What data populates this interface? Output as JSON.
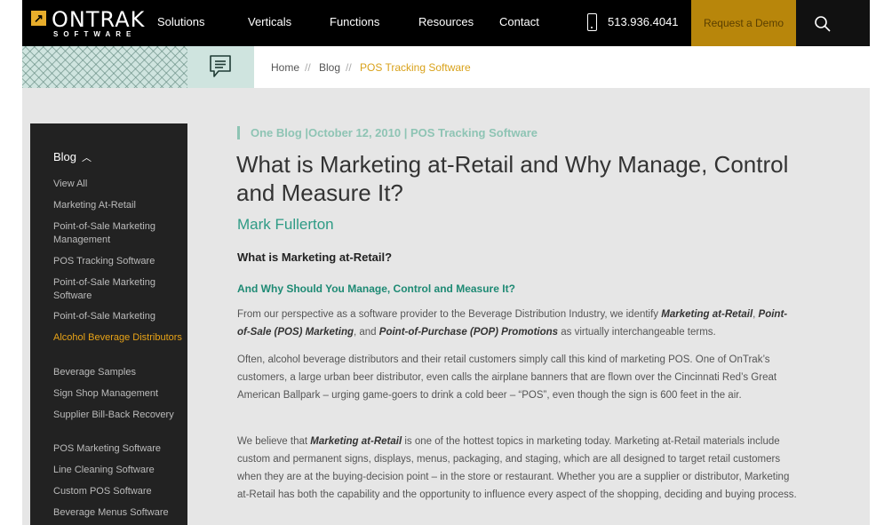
{
  "header": {
    "logo_mark": "↗",
    "logo_word": "ONTRAK",
    "logo_sub": "SOFTWARE",
    "nav": [
      "Solutions",
      "Verticals",
      "Functions",
      "Resources",
      "Contact"
    ],
    "phone": "513.936.4041",
    "demo_label": "Request a Demo",
    "icons": {
      "phone": "mobile-phone-icon",
      "search": "search-icon",
      "chat": "chat-bubble-icon"
    },
    "colors": {
      "bar": "#000000",
      "demo": "#b8860b",
      "accent": "#e8ad2b"
    }
  },
  "breadcrumb": {
    "home": "Home",
    "sep": "//",
    "blog": "Blog",
    "current": "POS Tracking Software"
  },
  "sidebar": {
    "heading": "Blog",
    "heading_icon": "chevron-up-icon",
    "items": [
      "View All",
      "Marketing At-Retail",
      "Point-of-Sale Marketing Management",
      "POS Tracking Software",
      "Point-of-Sale Marketing Software",
      "Point-of-Sale Marketing",
      "Alcohol Beverage Distributors",
      "Beverage Samples",
      "Sign Shop Management",
      "Supplier Bill-Back Recovery",
      "POS Marketing Software",
      "Line Cleaning Software",
      "Custom POS Software",
      "Beverage Menus Software"
    ],
    "active_index": 6
  },
  "article": {
    "meta": "One Blog |October 12, 2010 | POS Tracking Software",
    "title": "What is Marketing at-Retail and Why Manage, Control and Measure It?",
    "author": "Mark Fullerton",
    "subhead": "What is Marketing at-Retail?",
    "subhead2": "And Why Should You Manage, Control and Measure It?",
    "p1": [
      "From our perspective as a software provider to the Beverage Distribution Industry, we identify ",
      "Marketing at-Retail",
      ", ",
      "Point-of-Sale (POS) Marketing",
      ", and ",
      "Point-of-Purchase (POP) Promotions",
      " as virtually interchangeable terms."
    ],
    "p2": "Often, alcohol beverage distributors and their retail customers simply call this kind of marketing POS.  One of OnTrak’s customers, a large urban beer distributor, even calls the airplane banners that are flown over the Cincinnati Red’s Great American Ballpark – urging game-goers to drink a cold beer – “POS”, even though the sign is 600 feet in the air.",
    "p3": [
      "We believe that ",
      "Marketing at-Retail",
      " is one of the hottest topics in marketing today.  Marketing at-Retail materials include custom and permanent signs, displays, menus, packaging, and staging, which are all designed to target retail customers when they are at the buying-decision point – in the store or restaurant.  Whether you are a supplier or distributor, Marketing at-Retail has both the capability and the opportunity to influence every aspect of the shopping, deciding and buying process."
    ]
  }
}
